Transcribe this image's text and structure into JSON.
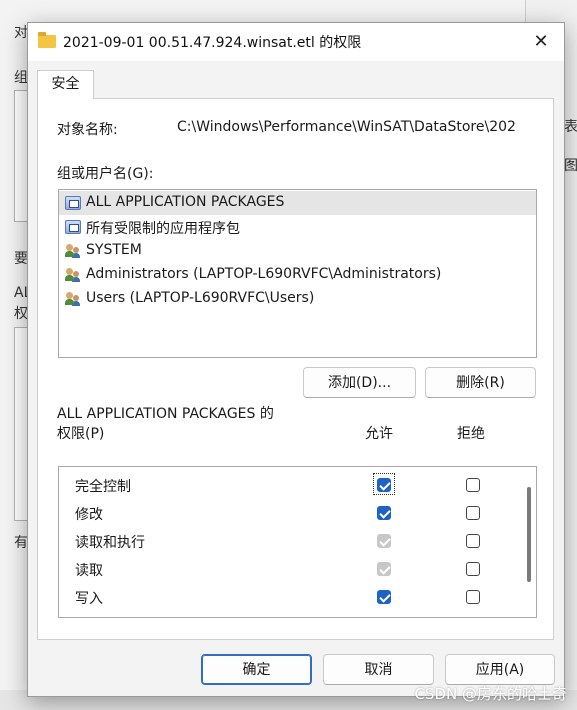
{
  "background": {
    "labels": [
      "对",
      "组",
      "要",
      "AL",
      "权",
      "有"
    ],
    "right_labels": [
      "表",
      "图"
    ]
  },
  "dialog": {
    "title": "2021-09-01 00.51.47.924.winsat.etl 的权限",
    "close_glyph": "✕",
    "tab_label": "安全",
    "object_name_label": "对象名称:",
    "object_name_value": "C:\\Windows\\Performance\\WinSAT\\DataStore\\202",
    "groups_label": "组或用户名(G):",
    "groups": [
      {
        "name": "ALL APPLICATION PACKAGES",
        "icon": "package-icon",
        "selected": true
      },
      {
        "name": "所有受限制的应用程序包",
        "icon": "package-icon",
        "selected": false
      },
      {
        "name": "SYSTEM",
        "icon": "users-icon",
        "selected": false
      },
      {
        "name": "Administrators (LAPTOP-L690RVFC\\Administrators)",
        "icon": "users-icon",
        "selected": false
      },
      {
        "name": "Users (LAPTOP-L690RVFC\\Users)",
        "icon": "users-icon",
        "selected": false
      }
    ],
    "add_button": "添加(D)...",
    "remove_button": "删除(R)",
    "perm_title_line1": "ALL APPLICATION PACKAGES 的",
    "perm_title_line2": "权限(P)",
    "allow_header": "允许",
    "deny_header": "拒绝",
    "permissions": [
      {
        "name": "完全控制",
        "allow": "checked",
        "deny": "unchecked"
      },
      {
        "name": "修改",
        "allow": "checked",
        "deny": "unchecked"
      },
      {
        "name": "读取和执行",
        "allow": "disabled-checked",
        "deny": "unchecked"
      },
      {
        "name": "读取",
        "allow": "disabled-checked",
        "deny": "unchecked"
      },
      {
        "name": "写入",
        "allow": "checked",
        "deny": "unchecked"
      }
    ],
    "ok_button": "确定",
    "cancel_button": "取消",
    "apply_button": "应用(A)"
  },
  "watermark": "CSDN @房东的哈士奇",
  "colors": {
    "accent": "#1d62c4",
    "selection": "#e5e5e5",
    "disabled_check": "#c8c8c8"
  }
}
